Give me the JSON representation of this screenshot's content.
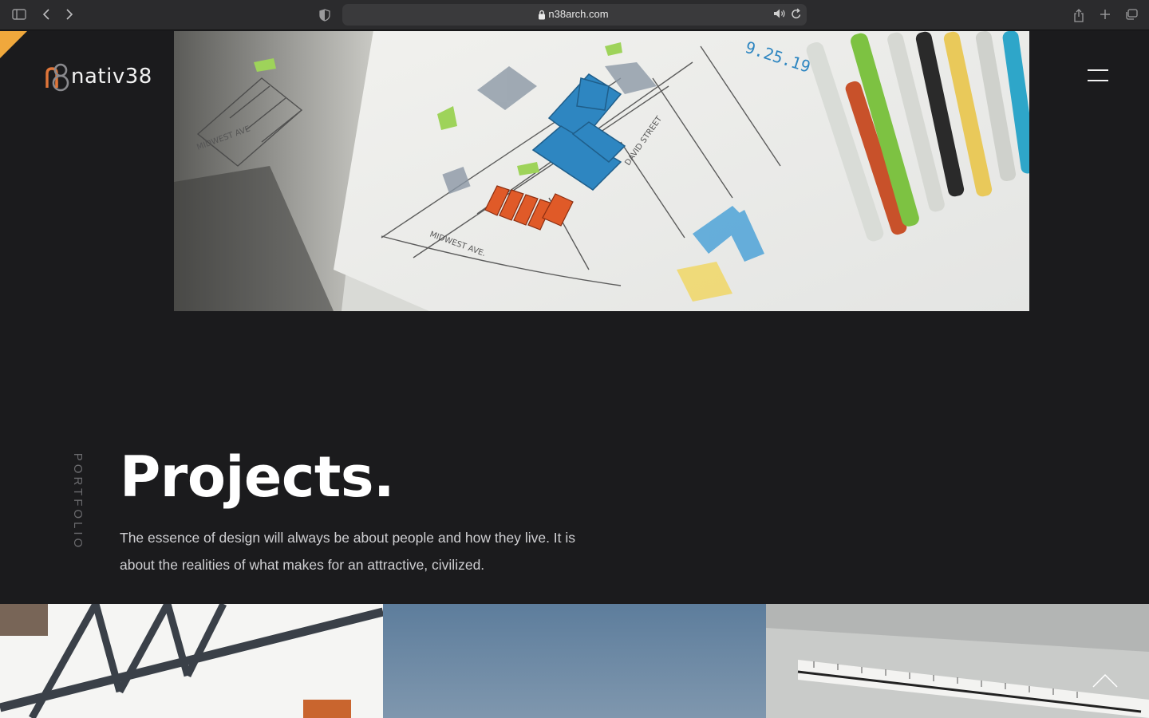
{
  "browser": {
    "url": "n38arch.com",
    "icons": [
      "sidebar-icon",
      "back-icon",
      "forward-icon",
      "shield-icon",
      "lock-icon",
      "audio-icon",
      "reload-icon",
      "share-icon",
      "new-tab-icon",
      "tabs-icon"
    ]
  },
  "site": {
    "logo_text": "nativ38",
    "logo_mark": "n8",
    "accent_color": "#f0a83c",
    "background_color": "#1b1b1d"
  },
  "section": {
    "label": "PORTFOLIO",
    "title": "Projects.",
    "description": "The essence of design will always be about people and how they live. It is about the realities of what makes for an attractive, civilized."
  },
  "hero": {
    "image": "architectural-sketch-with-markers"
  },
  "gallery": {
    "tiles": [
      "steel-truss-structure",
      "blue-sky",
      "architect-scale-ruler"
    ]
  }
}
